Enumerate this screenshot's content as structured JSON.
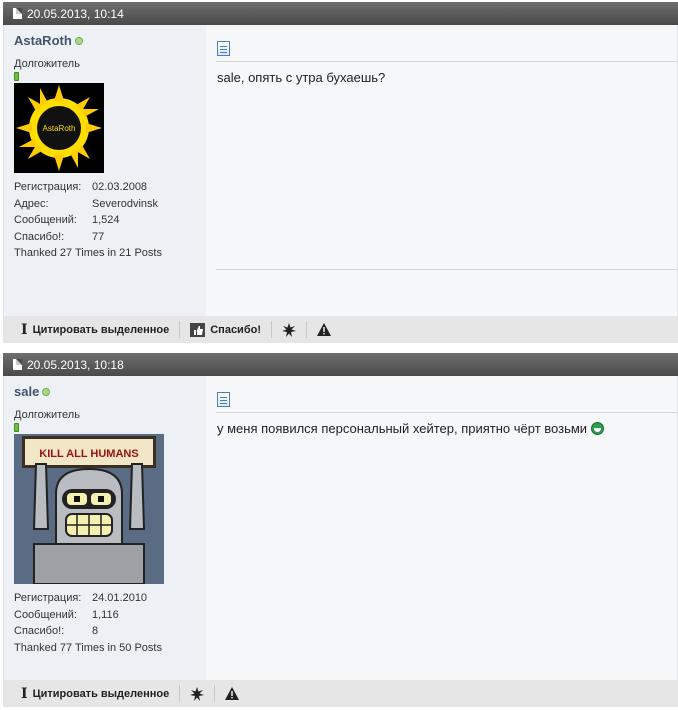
{
  "posts": [
    {
      "date": "20.05.2013, 10:14",
      "username": "AstaRoth",
      "user_title": "Долгожитель",
      "avatar_text": "AstaRoth",
      "stats": [
        {
          "label": "Регистрация:",
          "value": "02.03.2008"
        },
        {
          "label": "Адрес:",
          "value": "Severodvinsk"
        },
        {
          "label": "Сообщений:",
          "value": "1,524"
        },
        {
          "label": "Спасибо!:",
          "value": "77"
        }
      ],
      "thanked": "Thanked 27 Times in 21 Posts",
      "message": "sale, опять с утра бухаешь?",
      "toolbar": {
        "quote": "Цитировать выделенное",
        "thanks": "Спасибо!"
      }
    },
    {
      "date": "20.05.2013, 10:18",
      "username": "sale",
      "user_title": "Долгожитель",
      "avatar_text": "KILL ALL HUMANS",
      "stats": [
        {
          "label": "Регистрация:",
          "value": "24.01.2010"
        },
        {
          "label": "Сообщений:",
          "value": "1,116"
        },
        {
          "label": "Спасибо!:",
          "value": "8"
        }
      ],
      "thanked": "Thanked 77 Times in 50 Posts",
      "message": "у меня появился персональный хейтер, приятно чёрт возьми",
      "toolbar": {
        "quote": "Цитировать выделенное"
      }
    }
  ]
}
